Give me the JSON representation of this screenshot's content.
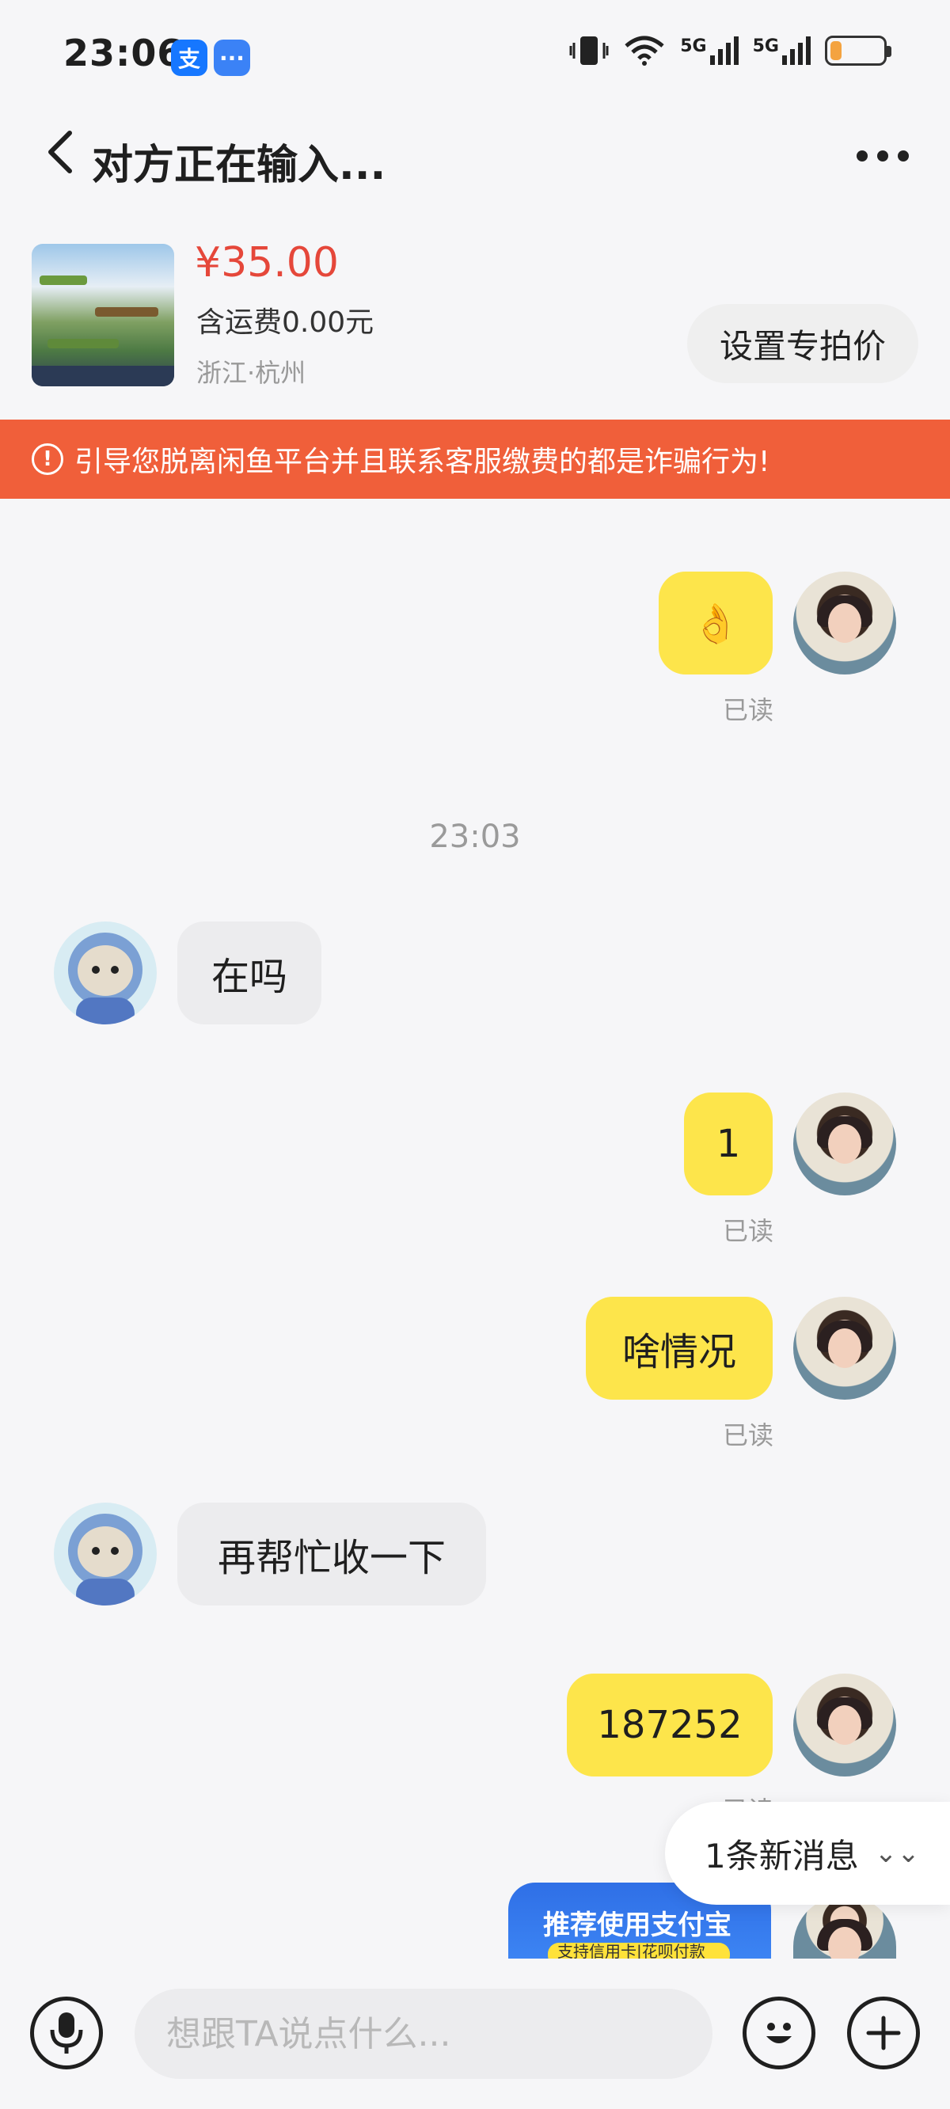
{
  "status_bar": {
    "time": "23:06",
    "app_icons": [
      "alipay-icon",
      "message-icon"
    ],
    "signal_label_1": "5G",
    "signal_label_2": "5G",
    "battery_level": 0.2
  },
  "header": {
    "title": "对方正在输入..."
  },
  "product": {
    "price": "¥35.00",
    "shipping": "含运费0.00元",
    "location": "浙江·杭州",
    "set_price_button": "设置专拍价"
  },
  "warning": {
    "text": "引导您脱离闲鱼平台并且联系客服缴费的都是诈骗行为!"
  },
  "messages": [
    {
      "sender": "me",
      "text": "👌",
      "status": "已读"
    },
    {
      "timestamp": "23:03"
    },
    {
      "sender": "other",
      "text": "在吗"
    },
    {
      "sender": "me",
      "text": "1",
      "status": "已读"
    },
    {
      "sender": "me",
      "text": "啥情况",
      "status": "已读"
    },
    {
      "sender": "other",
      "text": "再帮忙收一下"
    },
    {
      "sender": "me",
      "text": "187252",
      "status": "已读"
    }
  ],
  "new_message_pill": "1条新消息",
  "promo": {
    "title": "推荐使用支付宝",
    "subtitle": "支持信用卡|花呗付款"
  },
  "input": {
    "placeholder": "想跟TA说点什么..."
  },
  "colors": {
    "accent_yellow": "#fde54b",
    "price_red": "#e5473a",
    "warning_orange": "#f05f3a"
  }
}
